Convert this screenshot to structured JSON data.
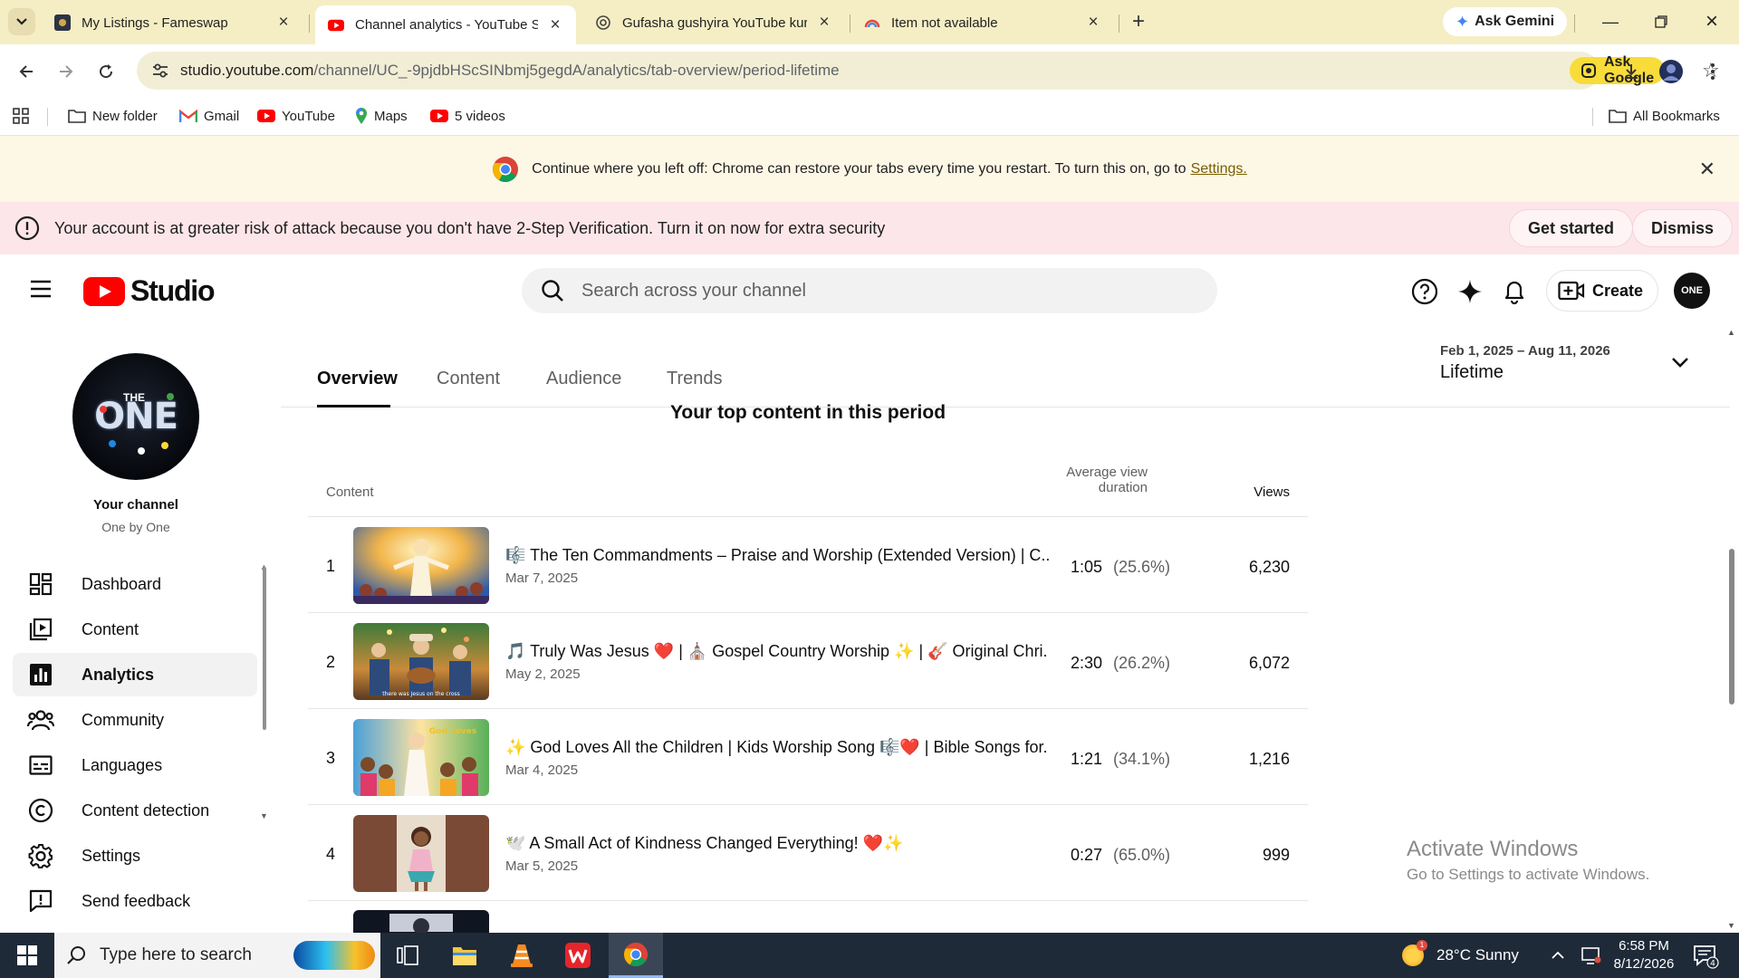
{
  "browser": {
    "tabs": [
      {
        "title": "My Listings - Fameswap",
        "active": false
      },
      {
        "title": "Channel analytics - YouTube Studio",
        "active": true
      },
      {
        "title": "Gufasha gushyira YouTube kuri",
        "active": false
      },
      {
        "title": "Item not available",
        "active": false
      }
    ],
    "new_tab": "+",
    "ask_gemini": "Ask Gemini",
    "url_host": "studio.youtube.com",
    "url_path": "/channel/UC_-9pjdbHScSINbmj5gegdA/analytics/tab-overview/period-lifetime",
    "ask_google": "Ask Google",
    "bookmarks": [
      {
        "label": "New folder",
        "icon": "folder-icon"
      },
      {
        "label": "Gmail",
        "icon": "gmail-icon"
      },
      {
        "label": "YouTube",
        "icon": "youtube-icon"
      },
      {
        "label": "Maps",
        "icon": "maps-icon"
      },
      {
        "label": "5 videos",
        "icon": "youtube-icon"
      }
    ],
    "all_bookmarks": "All Bookmarks",
    "restore_message": "Continue where you left off: Chrome can restore your tabs every time you restart. To turn this on, go to",
    "restore_link": "Settings."
  },
  "security_banner": {
    "message": "Your account is at greater risk of attack because you don't have 2-Step Verification. Turn it on now for extra security",
    "get_started": "Get started",
    "dismiss": "Dismiss"
  },
  "studio": {
    "logo_text": "Studio",
    "search_placeholder": "Search across your channel",
    "create_label": "Create",
    "avatar_text": "ONE"
  },
  "sidebar": {
    "your_channel": "Your channel",
    "channel_name": "One by One",
    "avatar_text": "ONE",
    "avatar_small": "THE",
    "items": [
      {
        "label": "Dashboard",
        "icon": "dashboard-icon",
        "active": false
      },
      {
        "label": "Content",
        "icon": "content-icon",
        "active": false
      },
      {
        "label": "Analytics",
        "icon": "analytics-icon",
        "active": true
      },
      {
        "label": "Community",
        "icon": "community-icon",
        "active": false
      },
      {
        "label": "Languages",
        "icon": "subtitles-icon",
        "active": false
      },
      {
        "label": "Content detection",
        "icon": "copyright-icon",
        "active": false
      },
      {
        "label": "Settings",
        "icon": "gear-icon",
        "active": false
      },
      {
        "label": "Send feedback",
        "icon": "feedback-icon",
        "active": false
      }
    ]
  },
  "analytics": {
    "tabs": [
      {
        "label": "Overview",
        "active": true
      },
      {
        "label": "Content",
        "active": false
      },
      {
        "label": "Audience",
        "active": false
      },
      {
        "label": "Trends",
        "active": false
      }
    ],
    "period_range": "Feb 1, 2025 – Aug 11, 2026",
    "period_label": "Lifetime",
    "top_content_heading": "Your top content in this period",
    "columns": {
      "content": "Content",
      "avg_view_duration_line1": "Average view",
      "avg_view_duration_line2": "duration",
      "views": "Views"
    },
    "rows": [
      {
        "rank": "1",
        "title": "🎼 The Ten Commandments – Praise and Worship (Extended Version) | C...",
        "date": "Mar 7, 2025",
        "duration": "1:05",
        "percent": "(25.6%)",
        "views": "6,230"
      },
      {
        "rank": "2",
        "title": "🎵 Truly Was Jesus ❤️ | ⛪ Gospel Country Worship ✨ | 🎸 Original Chri...",
        "date": "May 2, 2025",
        "duration": "2:30",
        "percent": "(26.2%)",
        "views": "6,072"
      },
      {
        "rank": "3",
        "title": "✨ God Loves All the Children | Kids Worship Song 🎼❤️ | Bible Songs for...",
        "date": "Mar 4, 2025",
        "duration": "1:21",
        "percent": "(34.1%)",
        "views": "1,216"
      },
      {
        "rank": "4",
        "title": "🕊️ A Small Act of Kindness Changed Everything! ❤️✨",
        "date": "Mar 5, 2025",
        "duration": "0:27",
        "percent": "(65.0%)",
        "views": "999"
      }
    ]
  },
  "watermark": {
    "line1": "Activate Windows",
    "line2": "Go to Settings to activate Windows."
  },
  "taskbar": {
    "search_placeholder": "Type here to search",
    "weather": "28°C  Sunny",
    "weather_badge": "1",
    "time": "6:58 PM",
    "date": "8/12/2026",
    "notifications": "4"
  }
}
